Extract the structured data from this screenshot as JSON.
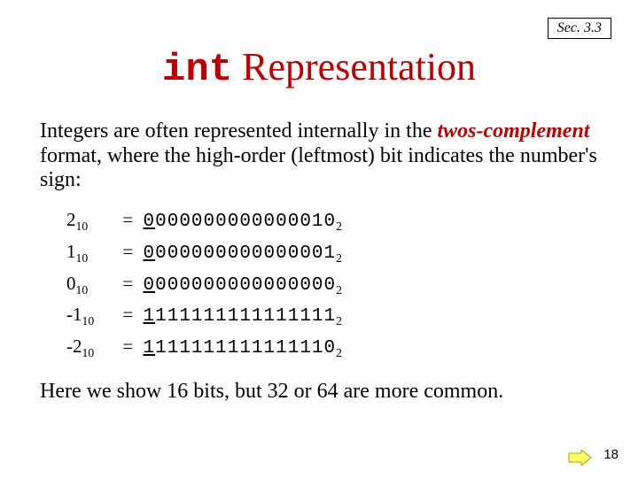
{
  "sec": "Sec. 3.3",
  "title_mono": "int",
  "title_rest": " Representation",
  "intro_a": "Integers are often represented internally in the ",
  "intro_em": "twos-complement",
  "intro_b": "  format, where the high-order (leftmost) bit indicates the number's sign:",
  "rows": [
    {
      "dec": "2",
      "sign": "0",
      "rest": "000000000000010"
    },
    {
      "dec": "1",
      "sign": "0",
      "rest": "000000000000001"
    },
    {
      "dec": "0",
      "sign": "0",
      "rest": "000000000000000"
    },
    {
      "dec": "-1",
      "sign": "1",
      "rest": "111111111111111"
    },
    {
      "dec": "-2",
      "sign": "1",
      "rest": "111111111111110"
    }
  ],
  "note": "Here we show 16 bits, but 32 or 64 are more common.",
  "page": "18",
  "base_dec": "10",
  "base_bin": "2",
  "eq": "="
}
